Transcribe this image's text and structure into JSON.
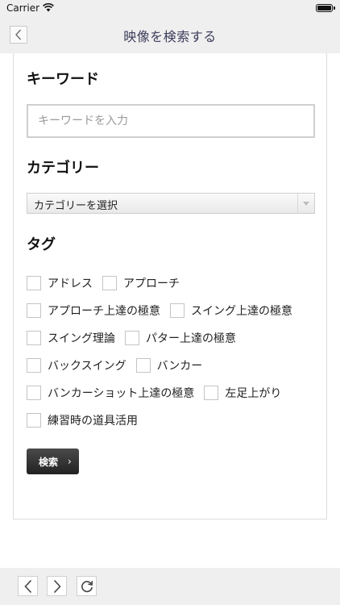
{
  "status": {
    "carrier": "Carrier"
  },
  "nav": {
    "title": "映像を検索する"
  },
  "keyword": {
    "label": "キーワード",
    "placeholder": "キーワードを入力",
    "value": ""
  },
  "category": {
    "label": "カテゴリー",
    "selected": "カテゴリーを選択"
  },
  "tags": {
    "label": "タグ",
    "rows": [
      [
        "アドレス",
        "アプローチ"
      ],
      [
        "アプローチ上達の極意",
        "スイング上達の極意"
      ],
      [
        "スイング理論",
        "パター上達の極意"
      ],
      [
        "バックスイング",
        "バンカー"
      ],
      [
        "バンカーショット上達の極意",
        "左足上がり"
      ],
      [
        "練習時の道具活用"
      ]
    ]
  },
  "search_button": {
    "label": "検索"
  },
  "toolbar": {
    "icons": [
      "chevron-left-icon",
      "chevron-right-icon",
      "reload-icon"
    ]
  }
}
